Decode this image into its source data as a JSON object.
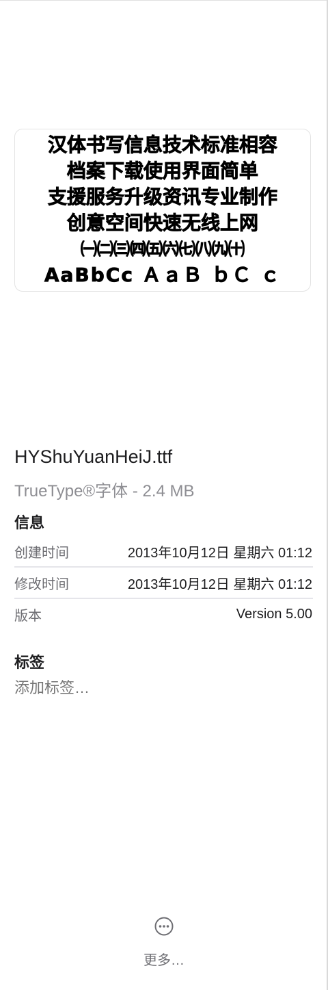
{
  "preview": {
    "lines": [
      "汉体书写信息技术标准相容",
      "档案下载使用界面简单",
      "支援服务升级资讯专业制作",
      "创意空间快速无线上网",
      "㈠㈡㈢㈣㈤㈥㈦㈧㈨㈩",
      "AaBbCc ＡａＢ ｂＣ ｃ"
    ]
  },
  "file": {
    "name": "HYShuYuanHeiJ.ttf",
    "kind": "TrueType®字体 - 2.4 MB"
  },
  "info": {
    "title": "信息",
    "rows": [
      {
        "label": "创建时间",
        "value": "2013年10月12日 星期六 01:12"
      },
      {
        "label": "修改时间",
        "value": "2013年10月12日 星期六 01:12"
      },
      {
        "label": "版本",
        "value": "Version 5.00"
      }
    ]
  },
  "tags": {
    "title": "标签",
    "placeholder": "添加标签…"
  },
  "more": {
    "icon": "ellipsis-circle-icon",
    "label": "更多…"
  }
}
